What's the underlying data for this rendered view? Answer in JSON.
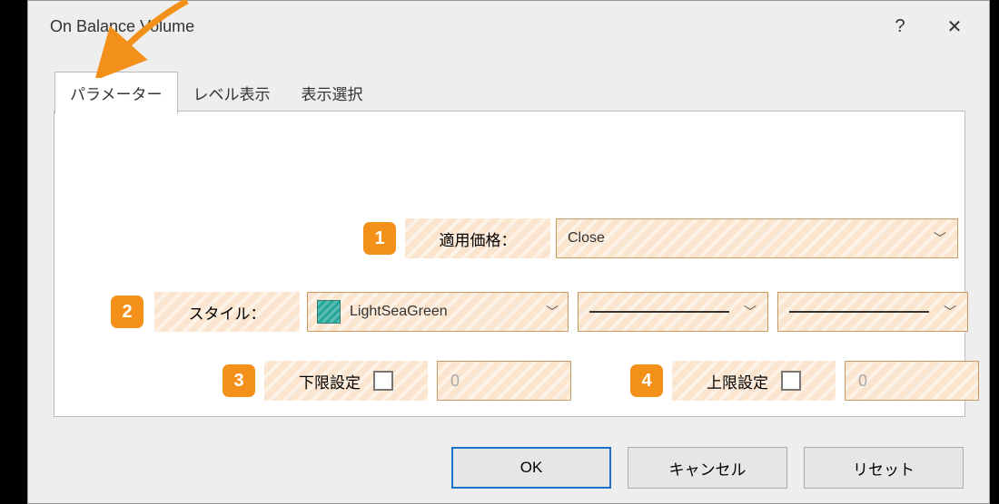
{
  "title": "On Balance Volume",
  "help": "?",
  "close": "✕",
  "tabs": [
    "パラメーター",
    "レベル表示",
    "表示選択"
  ],
  "annots": {
    "a1": "1",
    "a2": "2",
    "a3": "3",
    "a4": "4"
  },
  "row1": {
    "label": "適用価格：",
    "value": "Close"
  },
  "row2": {
    "label": "スタイル：",
    "color": "LightSeaGreen"
  },
  "row3": {
    "label": "下限設定",
    "value": "0"
  },
  "row4": {
    "label": "上限設定",
    "value": "0"
  },
  "buttons": {
    "ok": "OK",
    "cancel": "キャンセル",
    "reset": "リセット"
  }
}
